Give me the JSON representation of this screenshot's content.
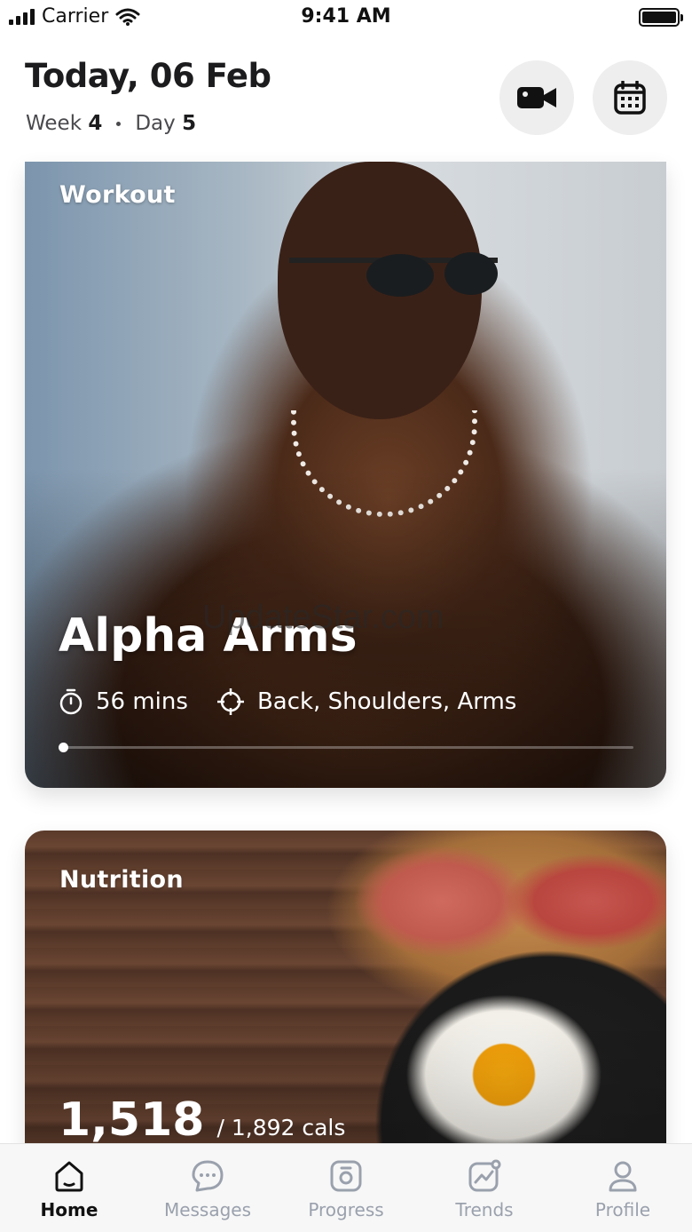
{
  "status_bar": {
    "carrier": "Carrier",
    "time": "9:41 AM"
  },
  "header": {
    "title": "Today, 06 Feb",
    "week_label": "Week",
    "week_value": "4",
    "day_label": "Day",
    "day_value": "5"
  },
  "actions": [
    "video-icon",
    "calendar-icon"
  ],
  "workout": {
    "label": "Workout",
    "title": "Alpha Arms",
    "duration": "56 mins",
    "focus": "Back, Shoulders, Arms",
    "progress": 0
  },
  "watermark": "UpdateStar.com",
  "nutrition": {
    "label": "Nutrition",
    "consumed": "1,518",
    "target": "/ 1,892 cals"
  },
  "tabs": [
    {
      "label": "Home",
      "icon": "home-icon",
      "active": true
    },
    {
      "label": "Messages",
      "icon": "chat-icon",
      "active": false
    },
    {
      "label": "Progress",
      "icon": "camera-icon",
      "active": false
    },
    {
      "label": "Trends",
      "icon": "trend-icon",
      "active": false
    },
    {
      "label": "Profile",
      "icon": "profile-icon",
      "active": false
    }
  ],
  "colors": {
    "text": "#1c1c1e",
    "tab_inactive": "#9aa1ad",
    "button_bg": "#eeeeee"
  }
}
